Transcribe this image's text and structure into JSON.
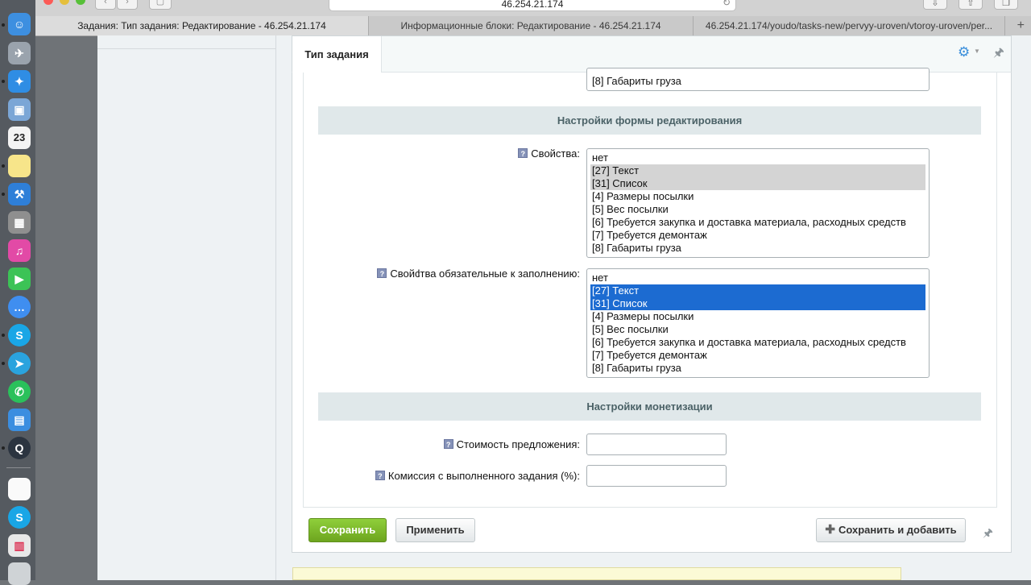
{
  "browser": {
    "url": "46.254.21.174",
    "tabs": [
      {
        "label": "Задания: Тип задания: Редактирование - 46.254.21.174",
        "active": true
      },
      {
        "label": "Информационные блоки: Редактирование - 46.254.21.174",
        "active": false
      },
      {
        "label": "46.254.21.174/youdo/tasks-new/pervyy-uroven/vtoroy-uroven/per...",
        "active": false
      }
    ],
    "new_tab_symbol": "+"
  },
  "dock": {
    "calendar_day": "23",
    "icons": [
      "finder-icon",
      "launchpad-icon",
      "safari-icon",
      "preview-icon",
      "calendar-icon",
      "notes-icon",
      "xcode-icon",
      "calculator-icon",
      "itunes-icon",
      "facetime-icon",
      "messenger-icon",
      "skype-icon",
      "telegram-icon",
      "whatsapp-icon",
      "simulator-icon",
      "quicktime-icon",
      "blank-doc-icon",
      "skype-icon-2",
      "keynote-icon",
      "trash-icon"
    ]
  },
  "header": {
    "tab_label": "Тип задания"
  },
  "partial_list": {
    "visible_item": "[8] Габариты груза"
  },
  "section_edit_form": {
    "title": "Настройки формы редактирования",
    "properties_label": "Свойства:",
    "properties_options": [
      {
        "text": "нет",
        "state": "normal"
      },
      {
        "text": "[27] Текст",
        "state": "gray"
      },
      {
        "text": "[31] Список",
        "state": "gray"
      },
      {
        "text": "[4] Размеры посылки",
        "state": "normal"
      },
      {
        "text": "[5] Вес посылки",
        "state": "normal"
      },
      {
        "text": "[6] Требуется закупка и доставка материала, расходных средств",
        "state": "normal"
      },
      {
        "text": "[7] Требуется демонтаж",
        "state": "normal"
      },
      {
        "text": "[8] Габариты груза",
        "state": "normal"
      }
    ],
    "required_label": "Свойства обязательные к заполнению:",
    "required_options": [
      {
        "text": "нет",
        "state": "normal"
      },
      {
        "text": "[27] Текст",
        "state": "blue"
      },
      {
        "text": "[31] Список",
        "state": "blue"
      },
      {
        "text": "[4] Размеры посылки",
        "state": "normal"
      },
      {
        "text": "[5] Вес посылки",
        "state": "normal"
      },
      {
        "text": "[6] Требуется закупка и доставка материала, расходных средств",
        "state": "normal"
      },
      {
        "text": "[7] Требуется демонтаж",
        "state": "normal"
      },
      {
        "text": "[8] Габариты груза",
        "state": "normal"
      }
    ]
  },
  "section_monetization": {
    "title": "Настройки монетизации",
    "offer_cost_label": "Стоимость предложения:",
    "offer_cost_value": "",
    "commission_label": "Комиссия с выполненного задания (%):",
    "commission_value": ""
  },
  "buttons": {
    "save": "Сохранить",
    "apply": "Применить",
    "save_and_add": "Сохранить и добавить"
  },
  "colors": {
    "save_button": "#7ab929",
    "selected_blue": "#1c6bd1",
    "section_bg": "#e0e8ea"
  }
}
